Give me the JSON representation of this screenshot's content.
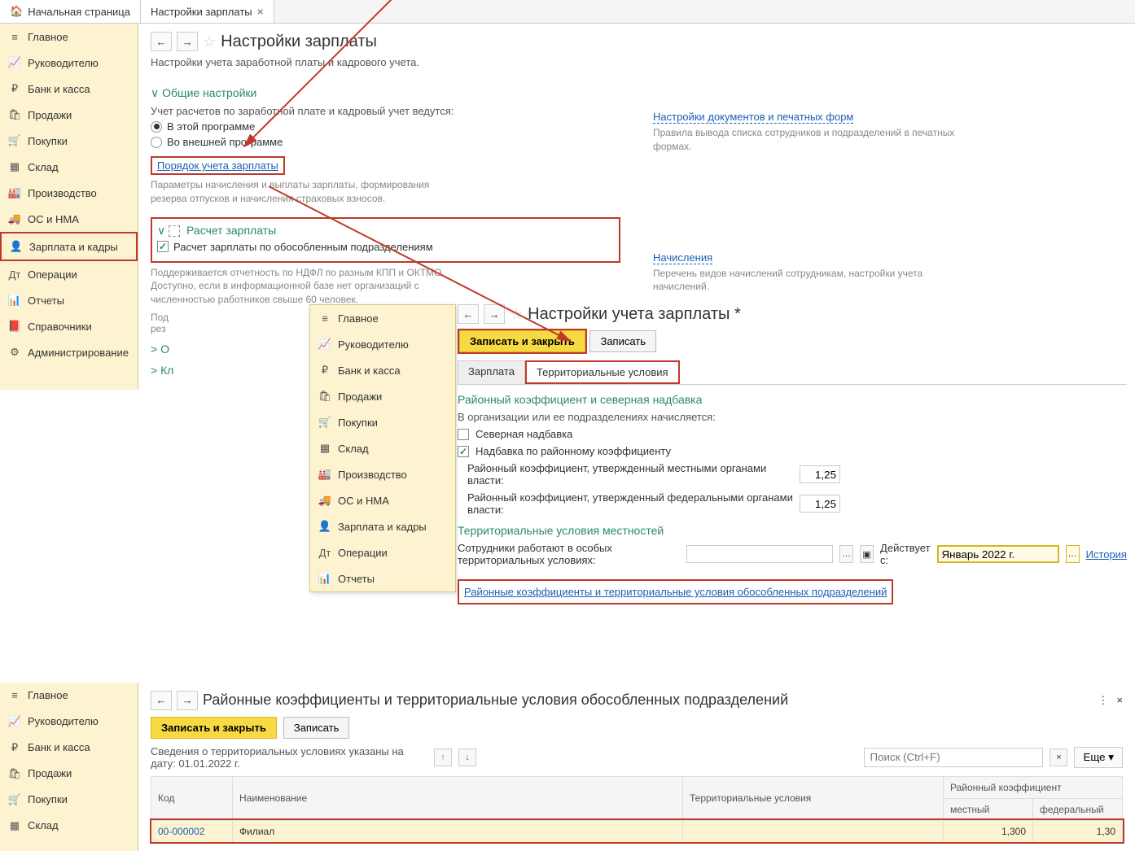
{
  "tabs": {
    "home": "Начальная страница",
    "current": "Настройки зарплаты"
  },
  "sidebar": [
    {
      "icon": "≡",
      "label": "Главное"
    },
    {
      "icon": "📈",
      "label": "Руководителю"
    },
    {
      "icon": "₽",
      "label": "Банк и касса"
    },
    {
      "icon": "🛍",
      "label": "Продажи"
    },
    {
      "icon": "🛒",
      "label": "Покупки"
    },
    {
      "icon": "▦",
      "label": "Склад"
    },
    {
      "icon": "🏭",
      "label": "Производство"
    },
    {
      "icon": "🚚",
      "label": "ОС и НМА"
    },
    {
      "icon": "👤",
      "label": "Зарплата и кадры"
    },
    {
      "icon": "Дт",
      "label": "Операции"
    },
    {
      "icon": "📊",
      "label": "Отчеты"
    },
    {
      "icon": "📕",
      "label": "Справочники"
    },
    {
      "icon": "⚙",
      "label": "Администрирование"
    }
  ],
  "sidebar2": [
    {
      "icon": "≡",
      "label": "Главное"
    },
    {
      "icon": "📈",
      "label": "Руководителю"
    },
    {
      "icon": "₽",
      "label": "Банк и касса"
    },
    {
      "icon": "🛍",
      "label": "Продажи"
    },
    {
      "icon": "🛒",
      "label": "Покупки"
    },
    {
      "icon": "▦",
      "label": "Склад"
    },
    {
      "icon": "🏭",
      "label": "Производство"
    },
    {
      "icon": "🚚",
      "label": "ОС и НМА"
    },
    {
      "icon": "👤",
      "label": "Зарплата и кадры"
    },
    {
      "icon": "Дт",
      "label": "Операции"
    },
    {
      "icon": "📊",
      "label": "Отчеты"
    }
  ],
  "sidebar3": [
    {
      "icon": "≡",
      "label": "Главное"
    },
    {
      "icon": "📈",
      "label": "Руководителю"
    },
    {
      "icon": "₽",
      "label": "Банк и касса"
    },
    {
      "icon": "🛍",
      "label": "Продажи"
    },
    {
      "icon": "🛒",
      "label": "Покупки"
    },
    {
      "icon": "▦",
      "label": "Склад"
    }
  ],
  "page": {
    "title": "Настройки зарплаты",
    "subtitle": "Настройки учета заработной платы и кадрового учета.",
    "general_header": "Общие настройки",
    "general_label": "Учет расчетов по заработной плате и кадровый учет ведутся:",
    "radio1": "В этой программе",
    "radio2": "Во внешней программе",
    "docs_link": "Настройки документов и печатных форм",
    "docs_help": "Правила вывода списка сотрудников и подразделений в печатных формах.",
    "order_link": "Порядок учета зарплаты",
    "order_help": "Параметры начисления и выплаты зарплаты, формирования резерва отпусков и начисления страховых взносов.",
    "calc_header": "Расчет зарплаты",
    "calc_check": "Расчет зарплаты по обособленным подразделениям",
    "calc_help": "Поддерживается отчетность по НДФЛ по разным КПП и ОКТМО. Доступно, если в информационной базе нет организаций с численностью работников свыше 60 человек.",
    "accruals_link": "Начисления",
    "accruals_help": "Перечень видов начислений сотрудникам, настройки учета начислений.",
    "sub1": "Под",
    "sub2": "рез",
    "coll1": "О",
    "coll2": "Кл"
  },
  "form": {
    "title": "Настройки учета зарплаты *",
    "save_close": "Записать и закрыть",
    "save": "Записать",
    "tab1": "Зарплата",
    "tab2": "Территориальные условия",
    "sect1": "Районный коэффициент и северная надбавка",
    "org_text": "В организации или ее подразделениях начисляется:",
    "chk1": "Северная надбавка",
    "chk2": "Надбавка по районному коэффициенту",
    "coef1_label": "Районный коэффициент, утвержденный местными органами власти:",
    "coef1_val": "1,25",
    "coef2_label": "Районный коэффициент, утвержденный федеральными органами власти:",
    "coef2_val": "1,25",
    "sect2": "Территориальные условия местностей",
    "terr_label": "Сотрудники работают в особых территориальных условиях:",
    "date_label": "Действует с:",
    "date_val": "Январь 2022 г.",
    "history": "История",
    "detail_link": "Районные коэффициенты и территориальные условия обособленных подразделений"
  },
  "bottom": {
    "title": "Районные коэффициенты и территориальные условия обособленных подразделений",
    "save_close": "Записать и закрыть",
    "save": "Записать",
    "info": "Сведения о территориальных условиях указаны на дату: 01.01.2022 г.",
    "search_ph": "Поиск (Ctrl+F)",
    "more": "Еще",
    "col1": "Код",
    "col2": "Наименование",
    "col3": "Территориальные условия",
    "col4": "Районный коэффициент",
    "col4a": "местный",
    "col4b": "федеральный",
    "row_code": "00-000002",
    "row_name": "Филиал",
    "row_local": "1,300",
    "row_fed": "1,30"
  }
}
